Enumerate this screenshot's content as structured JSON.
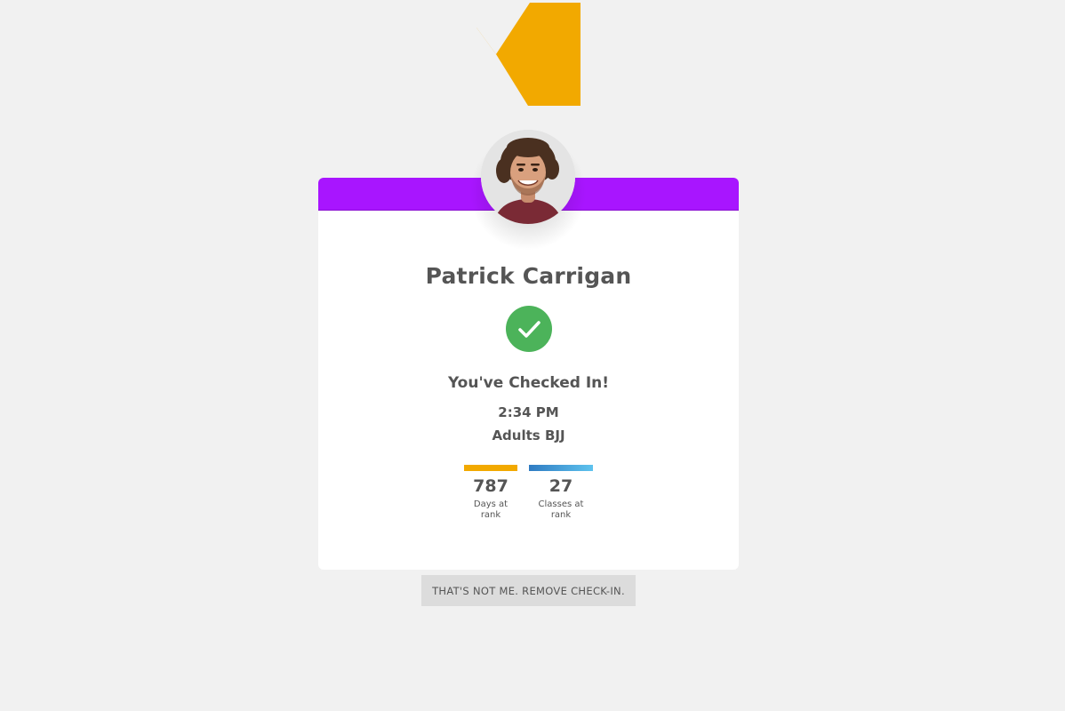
{
  "brand": {
    "logo_icon": "k-logo-icon",
    "logo_color": "#f2a900"
  },
  "card": {
    "accent_color": "#a815ff",
    "avatar_icon": "avatar",
    "name": "Patrick Carrigan",
    "status_icon": "check-circle-icon",
    "status_color": "#4cb35a",
    "status_text": "You've Checked In!",
    "time": "2:34 PM",
    "class_name": "Adults BJJ",
    "stats": [
      {
        "value": "787",
        "label": "Days at rank",
        "color": "#f2a900"
      },
      {
        "value": "27",
        "label": "Classes at rank",
        "color": "#2f7bc2"
      }
    ]
  },
  "actions": {
    "remove_label": "THAT'S NOT ME. REMOVE CHECK-IN."
  }
}
